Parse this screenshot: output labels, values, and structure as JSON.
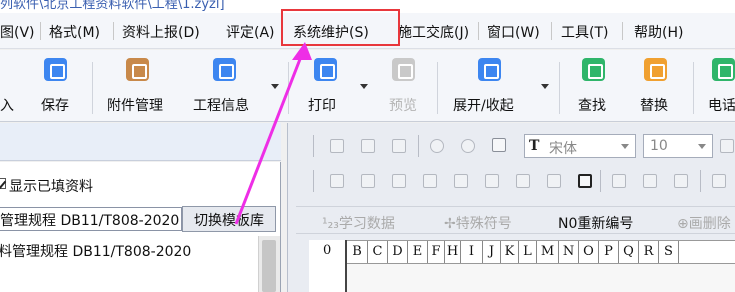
{
  "window": {
    "title": "列软件\\北京工程资料软件\\工程\\1.zyzl]"
  },
  "menubar": {
    "items": [
      "图(V)",
      "格式(M)",
      "资料上报(D)",
      "评定(A)",
      "系统维护(S)",
      "施工交底(J)",
      "窗口(W)",
      "工具(T)",
      "帮助(H)"
    ],
    "highlighted": "系统维护(S)",
    "highlight_color": "#e8373c"
  },
  "toolbar": {
    "buttons": [
      {
        "label": "入",
        "icon": "import-icon",
        "color": ""
      },
      {
        "label": "保存",
        "icon": "save-icon",
        "color": "#3d86f0"
      },
      {
        "label": "附件管理",
        "icon": "attachment-icon",
        "color": "#c8894a"
      },
      {
        "label": "工程信息",
        "icon": "project-info-icon",
        "color": "#3d86f0"
      },
      {
        "label": "打印",
        "icon": "print-icon",
        "color": "#3d86f0"
      },
      {
        "label": "预览",
        "icon": "preview-icon",
        "color": "#c9c9c9"
      },
      {
        "label": "展开/收起",
        "icon": "expand-icon",
        "color": "#3d86f0"
      },
      {
        "label": "查找",
        "icon": "search-icon",
        "color": "#2fb56a"
      },
      {
        "label": "替换",
        "icon": "replace-icon",
        "color": "#f0a030"
      },
      {
        "label": "电话",
        "icon": "phone-icon",
        "color": "#2fb56a"
      }
    ]
  },
  "left_panel": {
    "show_filled_label": "显示已填资料",
    "regulation_value": "管理规程 DB11/T808-2020",
    "switch_button": "切换模板库",
    "tree_item": "料管理规程 DB11/T808-2020"
  },
  "format_bar": {
    "font_name": "宋体",
    "font_size": "10",
    "font_glyph": "T",
    "actions": [
      {
        "label": "¹₂₃学习数据",
        "enabled": false
      },
      {
        "label": "✢特殊符号",
        "enabled": false
      },
      {
        "label": "N0重新编号",
        "enabled": true
      },
      {
        "label": "⊕画删除",
        "enabled": false
      }
    ]
  },
  "sheet": {
    "corner": "0",
    "columns": [
      "B",
      "C",
      "D",
      "E",
      "F",
      "H",
      "I",
      "J",
      "K",
      "L",
      "M",
      "N",
      "O",
      "P",
      "Q",
      "R",
      "S"
    ]
  },
  "annotation": {
    "arrow_color": "#ee2ee6"
  }
}
